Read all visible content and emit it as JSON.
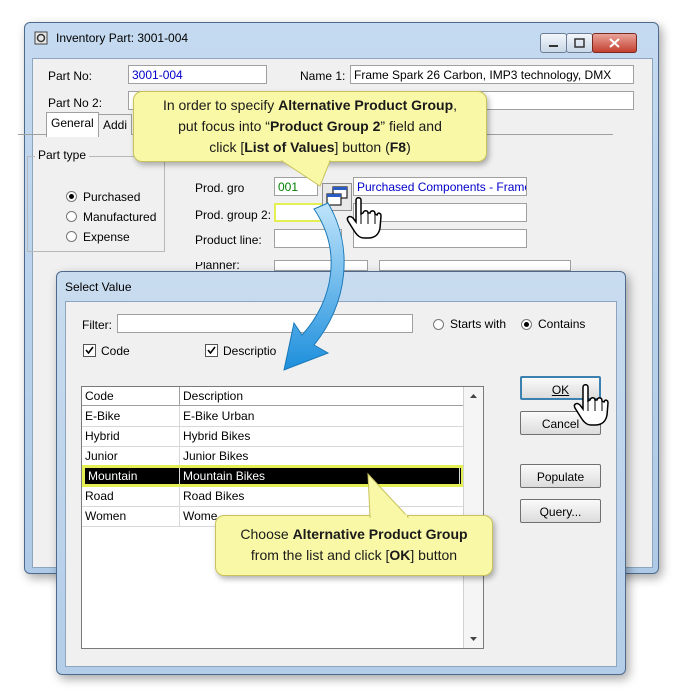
{
  "main_window": {
    "title": "Inventory Part: 3001-004",
    "part_no_label": "Part No:",
    "part_no_value": "3001-004",
    "name1_label": "Name 1:",
    "name1_value": "Frame Spark 26 Carbon, IMP3 technology, DMX",
    "part_no2_label": "Part No 2:",
    "tabs": [
      "General",
      "Addi"
    ],
    "part_type": {
      "title": "Part type",
      "options": [
        "Purchased",
        "Manufactured",
        "Expense"
      ],
      "selected": "Purchased"
    },
    "prod_group_label": "Prod. gro",
    "prod_group_value": "001",
    "prod_group_desc": "Purchased Components - Frames",
    "prod_group2_label": "Prod. group 2:",
    "product_line_label": "Product line:",
    "planner_label": "Planner:"
  },
  "dialog": {
    "title": "Select Value",
    "filter_label": "Filter:",
    "filter_value": "",
    "starts_with_label": "Starts with",
    "contains_label": "Contains",
    "selected_match": "Contains",
    "code_checkbox_label": "Code",
    "description_checkbox_label": "Descriptio",
    "columns": [
      "Code",
      "Description"
    ],
    "rows": [
      {
        "code": "E-Bike",
        "description": "E-Bike Urban"
      },
      {
        "code": "Hybrid",
        "description": "Hybrid Bikes"
      },
      {
        "code": "Junior",
        "description": "Junior Bikes"
      },
      {
        "code": "Mountain",
        "description": "Mountain Bikes"
      },
      {
        "code": "Road",
        "description": "Road Bikes"
      },
      {
        "code": "Women",
        "description": "Wome"
      }
    ],
    "selected_row": "Mountain",
    "ok_label": "OK",
    "cancel_label": "Cancel",
    "populate_label": "Populate",
    "query_label": "Query..."
  },
  "callouts": {
    "top": {
      "l1a": "In order to specify ",
      "l1b": "Alternative Product Group",
      "l1c": ",",
      "l2a": "put focus into “",
      "l2b": "Product Group 2",
      "l2c": "” field and",
      "l3a": "click [",
      "l3b": "List of Values",
      "l3c": "] button (",
      "l3d": "F8",
      "l3e": ")"
    },
    "bottom": {
      "l1a": "Choose ",
      "l1b": "Alternative Product Group",
      "l2a": "from the list and click [",
      "l2b": "OK",
      "l2c": "] button"
    }
  },
  "colors": {
    "callout_fill": "#f9f8a6",
    "highlight_border": "#e3ef52",
    "arrow_blue": "#3aa7e8"
  }
}
